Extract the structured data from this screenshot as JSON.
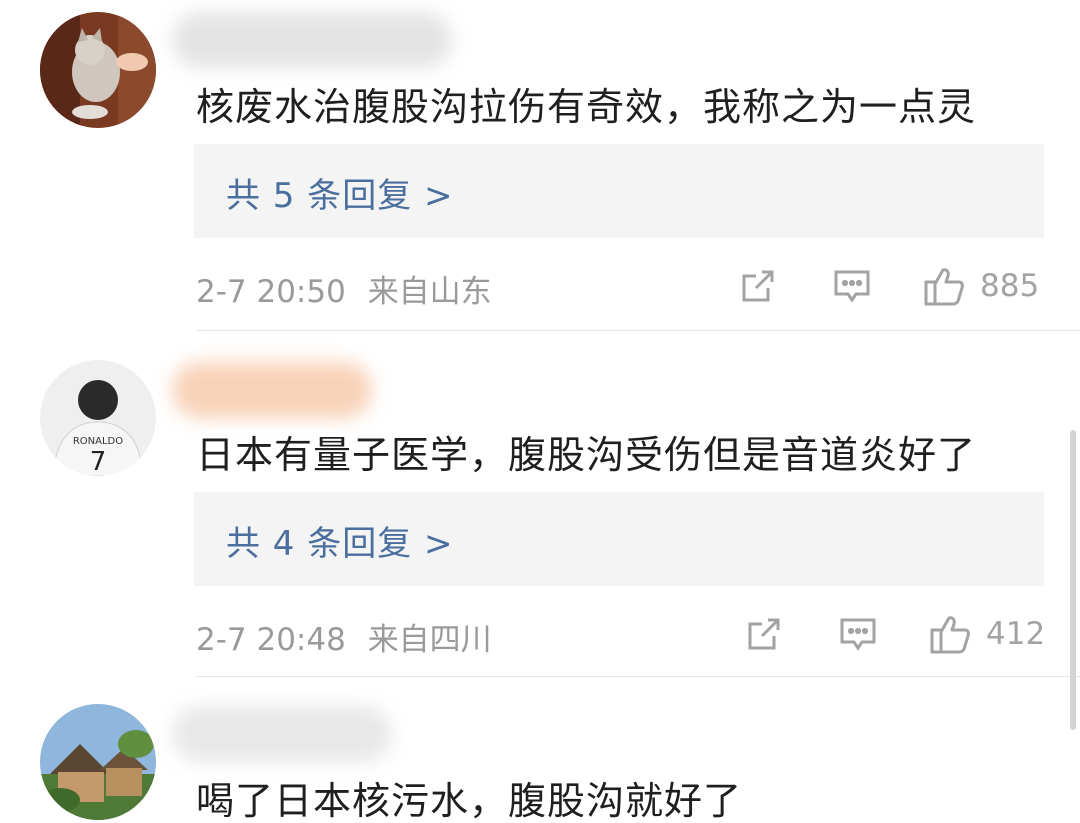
{
  "comments": [
    {
      "text": "核废水治腹股沟拉伤有奇效，我称之为一点灵",
      "replies": "共 5 条回复 >",
      "date": "2-7 20:50",
      "location": "来自山东",
      "likes": "885",
      "avatar_icon": "cat-avatar-icon"
    },
    {
      "text": "日本有量子医学，腹股沟受伤但是音道炎好了",
      "replies": "共 4 条回复 >",
      "date": "2-7 20:48",
      "location": "来自四川",
      "likes": "412",
      "avatar_icon": "ronaldo-jersey-avatar-icon"
    },
    {
      "text": "喝了日本核污水，腹股沟就好了",
      "avatar_icon": "cottage-avatar-icon"
    }
  ],
  "icons": {
    "share": "share-icon",
    "comment": "comment-icon",
    "like": "thumbs-up-icon"
  },
  "colors": {
    "reply_link": "#4a6f9e",
    "meta": "#9a9a9a",
    "reply_box_bg": "#f4f4f4"
  }
}
